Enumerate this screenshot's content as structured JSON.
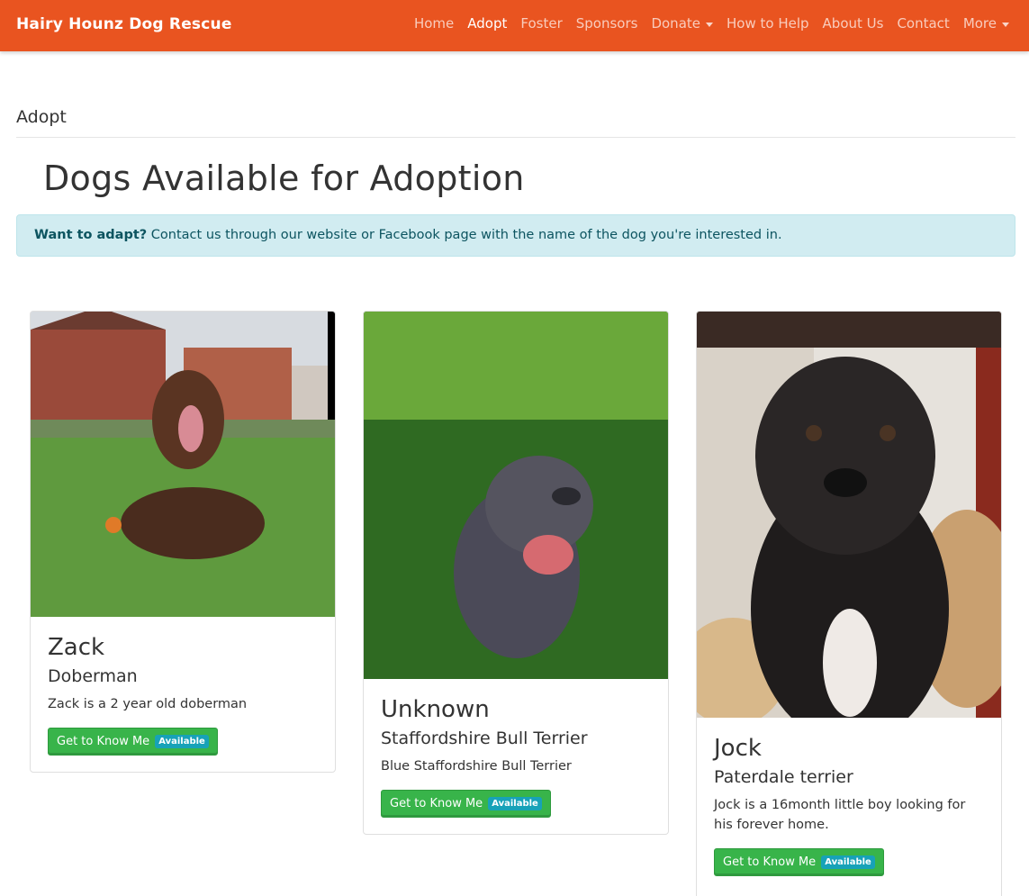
{
  "navbar": {
    "brand": "Hairy Hounz Dog Rescue",
    "items": [
      {
        "label": "Home",
        "active": false,
        "dropdown": false
      },
      {
        "label": "Adopt",
        "active": true,
        "dropdown": false
      },
      {
        "label": "Foster",
        "active": false,
        "dropdown": false
      },
      {
        "label": "Sponsors",
        "active": false,
        "dropdown": false
      },
      {
        "label": "Donate",
        "active": false,
        "dropdown": true
      },
      {
        "label": "How to Help",
        "active": false,
        "dropdown": false
      },
      {
        "label": "About Us",
        "active": false,
        "dropdown": false
      },
      {
        "label": "Contact",
        "active": false,
        "dropdown": false
      },
      {
        "label": "More",
        "active": false,
        "dropdown": true
      }
    ],
    "accent_color": "#e95420"
  },
  "breadcrumb": "Adopt",
  "page_title": "Dogs Available for Adoption",
  "alert": {
    "strong": "Want to adapt?",
    "text": "Contact us through our website or Facebook page with the name of the dog you're interested in."
  },
  "dogs": [
    {
      "name": "Zack",
      "breed": "Doberman",
      "description": "Zack is a 2 year old doberman",
      "button_label": "Get to Know Me",
      "badge": "Available"
    },
    {
      "name": "Unknown",
      "breed": "Staffordshire Bull Terrier",
      "description": "Blue Staffordshire Bull Terrier",
      "button_label": "Get to Know Me",
      "badge": "Available"
    },
    {
      "name": "Jock",
      "breed": "Paterdale terrier",
      "description": "Jock is a 16month little boy looking for his forever home.",
      "button_label": "Get to Know Me",
      "badge": "Available"
    }
  ],
  "colors": {
    "button": "#38b44a",
    "badge": "#17a2b8",
    "alert_bg": "#d1ecf1",
    "alert_text": "#0c5460"
  }
}
